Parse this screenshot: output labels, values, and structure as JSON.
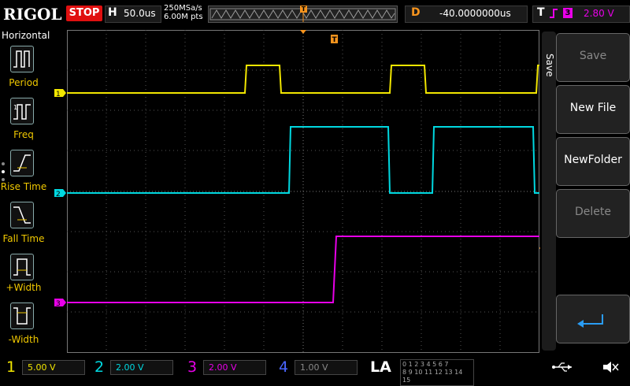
{
  "brand": "RIGOL",
  "run_state": "STOP",
  "timebase": {
    "key": "H",
    "value": "50.0us"
  },
  "sampling": {
    "rate": "250MSa/s",
    "points": "6.00M pts"
  },
  "delay": {
    "key": "D",
    "value": "-40.0000000us"
  },
  "trigger": {
    "key": "T",
    "source": "3",
    "level": "2.80 V",
    "marker": "T"
  },
  "horizontal_menu": {
    "title": "Horizontal",
    "items": [
      "Period",
      "Freq",
      "Rise Time",
      "Fall Time",
      "+Width",
      "-Width"
    ]
  },
  "save_menu": {
    "tab_label": "Save",
    "buttons": [
      "Save",
      "New File",
      "NewFolder",
      "Delete"
    ]
  },
  "channels": [
    {
      "num": "1",
      "scale": "5.00 V",
      "color": "#f2e600"
    },
    {
      "num": "2",
      "scale": "2.00 V",
      "color": "#00d8e0"
    },
    {
      "num": "3",
      "scale": "2.00 V",
      "color": "#e800e8"
    },
    {
      "num": "4",
      "scale": "1.00 V",
      "color": "#4a66ff"
    }
  ],
  "la": {
    "label": "LA",
    "bits_top": "0 1 2 3 4 5 6 7",
    "bits_bottom": "8 9 10 11 12 13 14 15"
  },
  "colors": {
    "trigger": "#f7941d",
    "menu_label": "#f0c800",
    "grid": "#555555"
  }
}
